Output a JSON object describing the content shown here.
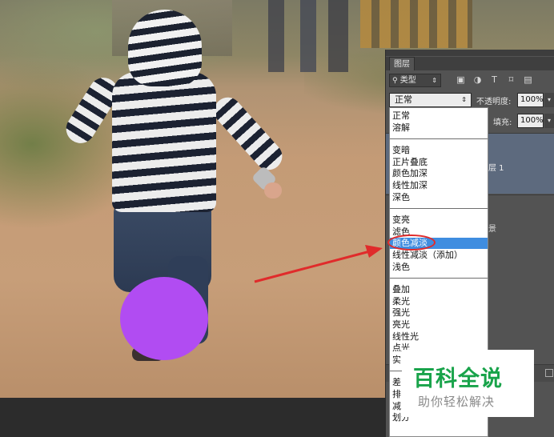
{
  "panel": {
    "tab_label": "图层",
    "filter": {
      "value": "类型",
      "icon": "search-icon"
    },
    "filter_icons": [
      "image-filter-icon",
      "adjustment-filter-icon",
      "text-filter-icon",
      "shape-filter-icon",
      "smart-object-filter-icon"
    ],
    "filter_icon_glyphs": [
      "▣",
      "◑",
      "T",
      "⌑",
      "▤"
    ],
    "blend_mode": "正常",
    "opacity_label": "不透明度:",
    "opacity_value": "100%",
    "fill_label": "填充:",
    "fill_value": "100%",
    "layer1_label": "层 1",
    "layer2_label": "景"
  },
  "dropdown": {
    "groups": [
      [
        "正常",
        "溶解"
      ],
      [
        "变暗",
        "正片叠底",
        "颜色加深",
        "线性加深",
        "深色"
      ],
      [
        "变亮",
        "滤色",
        "颜色减淡",
        "线性减淡（添加）",
        "浅色"
      ],
      [
        "叠加",
        "柔光",
        "强光",
        "亮光",
        "线性光",
        "点光",
        "实"
      ],
      [
        "差",
        "排",
        "减",
        "划分"
      ]
    ],
    "selected": "颜色减淡"
  },
  "watermark": {
    "title": "百科全说",
    "subtitle": "助你轻松解决"
  },
  "colors": {
    "accent_selected": "#3f8de0",
    "annotation_red": "#e02b2b",
    "circle_purple": "#b14cf2",
    "watermark_green": "#18a34a"
  }
}
